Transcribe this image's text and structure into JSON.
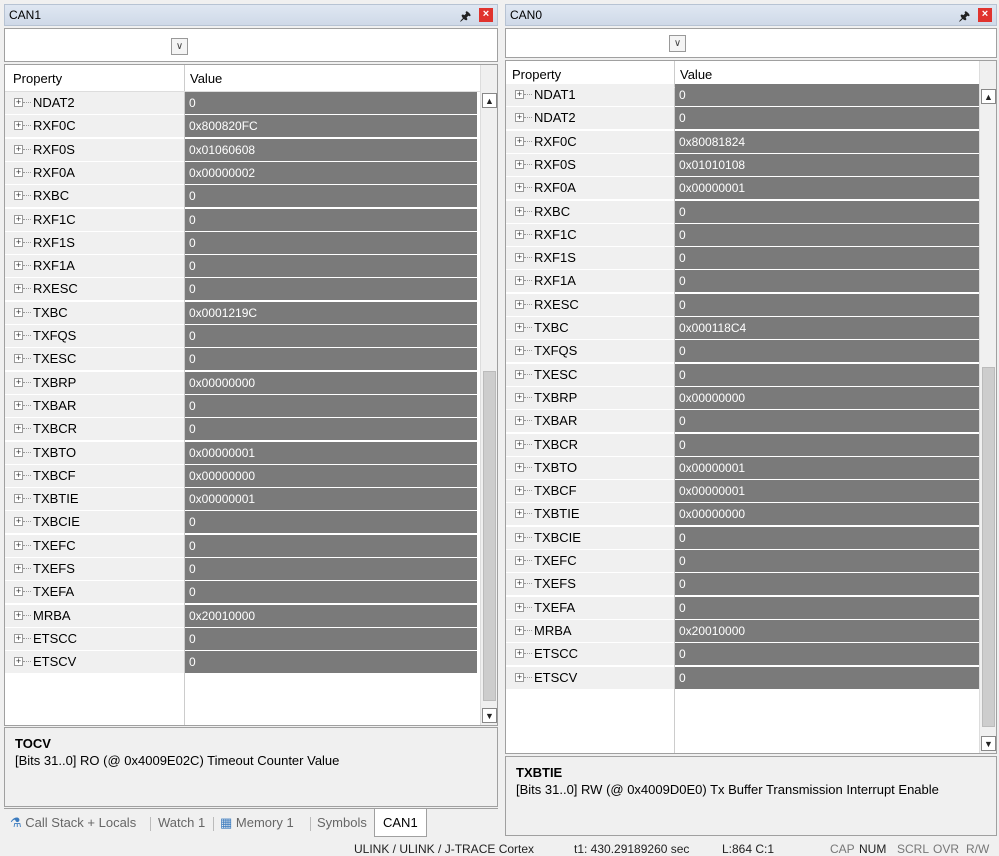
{
  "left_panel": {
    "title": "CAN1",
    "pin_icon": "pin-icon",
    "close_icon": "close-icon",
    "header": {
      "property": "Property",
      "value": "Value"
    },
    "rows": [
      {
        "name": "NDAT2",
        "value": "0"
      },
      {
        "name": "RXF0C",
        "value": "0x800820FC"
      },
      {
        "name": "RXF0S",
        "value": "0x01060608"
      },
      {
        "name": "RXF0A",
        "value": "0x00000002"
      },
      {
        "name": "RXBC",
        "value": "0"
      },
      {
        "name": "RXF1C",
        "value": "0"
      },
      {
        "name": "RXF1S",
        "value": "0"
      },
      {
        "name": "RXF1A",
        "value": "0"
      },
      {
        "name": "RXESC",
        "value": "0"
      },
      {
        "name": "TXBC",
        "value": "0x0001219C"
      },
      {
        "name": "TXFQS",
        "value": "0"
      },
      {
        "name": "TXESC",
        "value": "0"
      },
      {
        "name": "TXBRP",
        "value": "0x00000000"
      },
      {
        "name": "TXBAR",
        "value": "0"
      },
      {
        "name": "TXBCR",
        "value": "0"
      },
      {
        "name": "TXBTO",
        "value": "0x00000001"
      },
      {
        "name": "TXBCF",
        "value": "0x00000000"
      },
      {
        "name": "TXBTIE",
        "value": "0x00000001"
      },
      {
        "name": "TXBCIE",
        "value": "0"
      },
      {
        "name": "TXEFC",
        "value": "0"
      },
      {
        "name": "TXEFS",
        "value": "0"
      },
      {
        "name": "TXEFA",
        "value": "0"
      },
      {
        "name": "MRBA",
        "value": "0x20010000"
      },
      {
        "name": "ETSCC",
        "value": "0"
      },
      {
        "name": "ETSCV",
        "value": "0"
      }
    ],
    "description": {
      "name": "TOCV",
      "text": "[Bits 31..0] RO (@ 0x4009E02C) Timeout Counter Value"
    },
    "tabs": [
      "Call Stack + Locals",
      "Watch 1",
      "Memory 1",
      "Symbols",
      "CAN1"
    ],
    "active_tab": "CAN1"
  },
  "right_panel": {
    "title": "CAN0",
    "pin_icon": "pin-icon",
    "close_icon": "close-icon",
    "header": {
      "property": "Property",
      "value": "Value"
    },
    "rows": [
      {
        "name": "NDAT1",
        "value": "0"
      },
      {
        "name": "NDAT2",
        "value": "0"
      },
      {
        "name": "RXF0C",
        "value": "0x80081824"
      },
      {
        "name": "RXF0S",
        "value": "0x01010108"
      },
      {
        "name": "RXF0A",
        "value": "0x00000001"
      },
      {
        "name": "RXBC",
        "value": "0"
      },
      {
        "name": "RXF1C",
        "value": "0"
      },
      {
        "name": "RXF1S",
        "value": "0"
      },
      {
        "name": "RXF1A",
        "value": "0"
      },
      {
        "name": "RXESC",
        "value": "0"
      },
      {
        "name": "TXBC",
        "value": "0x000118C4"
      },
      {
        "name": "TXFQS",
        "value": "0"
      },
      {
        "name": "TXESC",
        "value": "0"
      },
      {
        "name": "TXBRP",
        "value": "0x00000000"
      },
      {
        "name": "TXBAR",
        "value": "0"
      },
      {
        "name": "TXBCR",
        "value": "0"
      },
      {
        "name": "TXBTO",
        "value": "0x00000001"
      },
      {
        "name": "TXBCF",
        "value": "0x00000001"
      },
      {
        "name": "TXBTIE",
        "value": "0x00000000"
      },
      {
        "name": "TXBCIE",
        "value": "0"
      },
      {
        "name": "TXEFC",
        "value": "0"
      },
      {
        "name": "TXEFS",
        "value": "0"
      },
      {
        "name": "TXEFA",
        "value": "0"
      },
      {
        "name": "MRBA",
        "value": "0x20010000"
      },
      {
        "name": "ETSCC",
        "value": "0"
      },
      {
        "name": "ETSCV",
        "value": "0"
      }
    ],
    "description": {
      "name": "TXBTIE",
      "text": "[Bits 31..0] RW (@ 0x4009D0E0) Tx Buffer Transmission Interrupt Enable"
    }
  },
  "status_bar": {
    "debugger": "ULINK / ULINK / J-TRACE Cortex",
    "time": "t1: 430.29189260 sec",
    "position": "L:864 C:1",
    "indicators": [
      "CAP",
      "NUM",
      "SCRL",
      "OVR",
      "R/W"
    ],
    "active_indicators": [
      "NUM"
    ]
  },
  "colors": {
    "value_bg": "#7a7a7a",
    "title_bg": "#cfd9e8",
    "close_red": "#e0332e"
  }
}
